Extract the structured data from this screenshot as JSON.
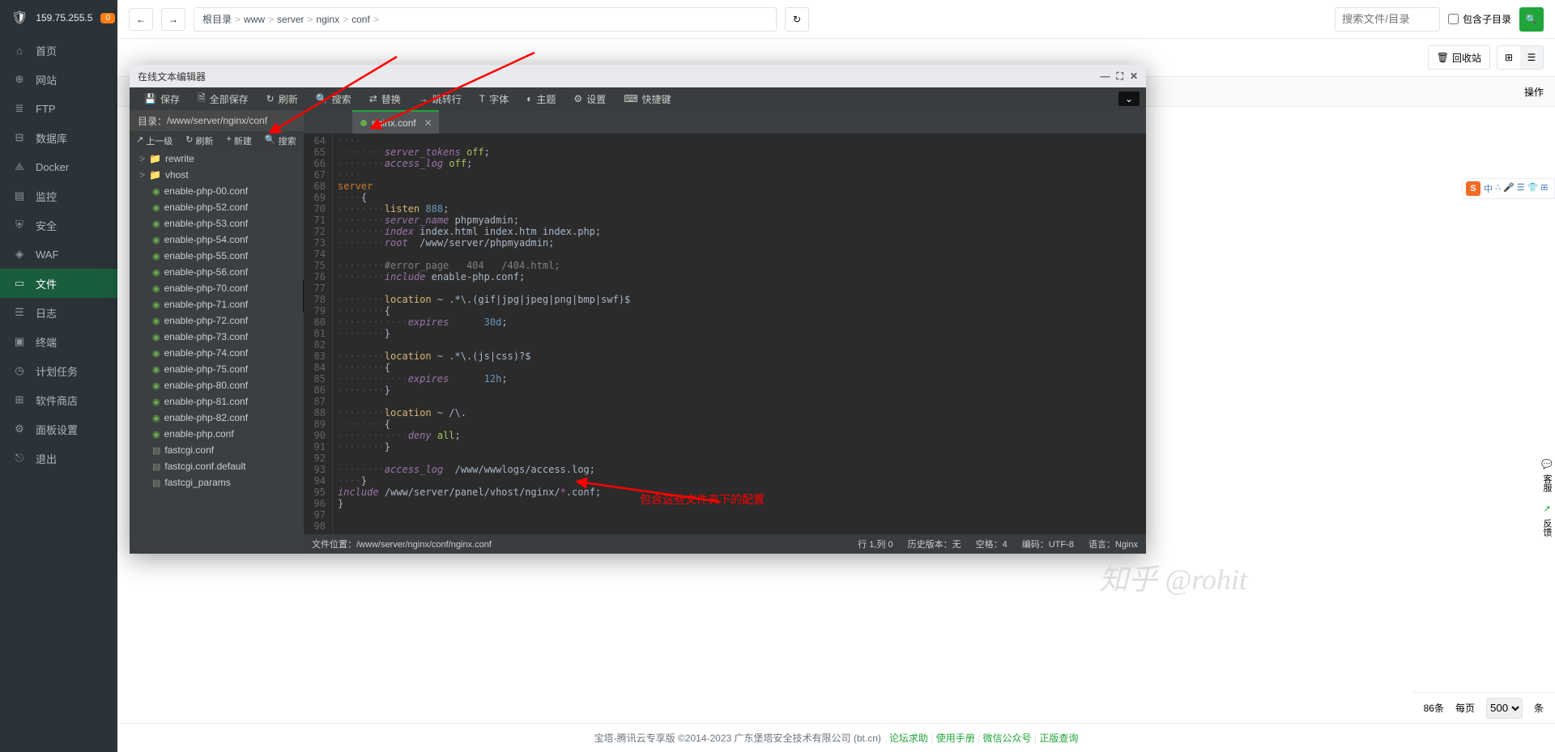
{
  "server_ip": "159.75.255.5",
  "badge": "0",
  "nav": [
    {
      "icon": "⌂",
      "label": "首页"
    },
    {
      "icon": "⊕",
      "label": "网站"
    },
    {
      "icon": "≣",
      "label": "FTP"
    },
    {
      "icon": "⊟",
      "label": "数据库"
    },
    {
      "icon": "⟁",
      "label": "Docker"
    },
    {
      "icon": "▤",
      "label": "监控"
    },
    {
      "icon": "⛨",
      "label": "安全"
    },
    {
      "icon": "◈",
      "label": "WAF"
    },
    {
      "icon": "▭",
      "label": "文件",
      "active": true
    },
    {
      "icon": "☰",
      "label": "日志"
    },
    {
      "icon": "▣",
      "label": "终端"
    },
    {
      "icon": "◷",
      "label": "计划任务"
    },
    {
      "icon": "⊞",
      "label": "软件商店"
    },
    {
      "icon": "⚙",
      "label": "面板设置"
    },
    {
      "icon": "⎋",
      "label": "退出"
    }
  ],
  "breadcrumb": [
    "根目录",
    "www",
    "server",
    "nginx",
    "conf"
  ],
  "search_placeholder": "搜索文件/目录",
  "include_subdir": "包含子目录",
  "recycle_label": "回收站",
  "table_op_header": "操作",
  "pagination": {
    "total": "86条",
    "per_page": "每页",
    "select": "500",
    "unit": "条"
  },
  "footer": {
    "copyright": "宝塔-腾讯云专享版 ©2014-2023 广东堡塔安全技术有限公司 (bt.cn)",
    "links": [
      "论坛求助",
      "使用手册",
      "微信公众号",
      "正版查询"
    ]
  },
  "modal": {
    "title": "在线文本编辑器",
    "toolbar": [
      {
        "icon": "💾",
        "label": "保存"
      },
      {
        "icon": "🗎",
        "label": "全部保存"
      },
      {
        "icon": "↻",
        "label": "刷新"
      },
      {
        "icon": "🔍",
        "label": "搜索"
      },
      {
        "icon": "⇄",
        "label": "替换"
      },
      {
        "icon": "→",
        "label": "跳转行"
      },
      {
        "icon": "T",
        "label": "字体"
      },
      {
        "icon": "◐",
        "label": "主题"
      },
      {
        "icon": "⚙",
        "label": "设置"
      },
      {
        "icon": "⌨",
        "label": "快捷键"
      }
    ],
    "path_label": "目录：",
    "path": "/www/server/nginx/conf",
    "left_toolbar": [
      {
        "icon": "↗",
        "label": "上一级"
      },
      {
        "icon": "↻",
        "label": "刷新"
      },
      {
        "icon": "+",
        "label": "新建"
      },
      {
        "icon": "🔍",
        "label": "搜索"
      }
    ],
    "tree": [
      {
        "type": "folder",
        "name": "rewrite",
        "chevron": ">"
      },
      {
        "type": "folder",
        "name": "vhost",
        "chevron": ">"
      },
      {
        "type": "conf",
        "name": "enable-php-00.conf"
      },
      {
        "type": "conf",
        "name": "enable-php-52.conf"
      },
      {
        "type": "conf",
        "name": "enable-php-53.conf"
      },
      {
        "type": "conf",
        "name": "enable-php-54.conf"
      },
      {
        "type": "conf",
        "name": "enable-php-55.conf"
      },
      {
        "type": "conf",
        "name": "enable-php-56.conf"
      },
      {
        "type": "conf",
        "name": "enable-php-70.conf"
      },
      {
        "type": "conf",
        "name": "enable-php-71.conf"
      },
      {
        "type": "conf",
        "name": "enable-php-72.conf"
      },
      {
        "type": "conf",
        "name": "enable-php-73.conf"
      },
      {
        "type": "conf",
        "name": "enable-php-74.conf"
      },
      {
        "type": "conf",
        "name": "enable-php-75.conf"
      },
      {
        "type": "conf",
        "name": "enable-php-80.conf"
      },
      {
        "type": "conf",
        "name": "enable-php-81.conf"
      },
      {
        "type": "conf",
        "name": "enable-php-82.conf"
      },
      {
        "type": "conf",
        "name": "enable-php.conf"
      },
      {
        "type": "file",
        "name": "fastcgi.conf"
      },
      {
        "type": "file",
        "name": "fastcgi.conf.default"
      },
      {
        "type": "file",
        "name": "fastcgi_params"
      }
    ],
    "tab_filename": "nginx.conf",
    "code_start_line": 64,
    "code_html": "    \n        <span class='dir'>server_tokens</span> <span class='val'>off</span><span class='pun'>;</span>\n        <span class='dir'>access_log</span> <span class='val'>off</span><span class='pun'>;</span>\n    \n<span class='kw'>server</span>\n    <span class='pun'>{</span>\n        <span class='prop'>listen</span> <span class='num'>888</span><span class='pun'>;</span>\n        <span class='dir'>server_name</span> <span class='pun'>phpmyadmin;</span>\n        <span class='dir'>index</span> <span class='pun'>index.html index.htm index.php;</span>\n        <span class='dir'>root</span>  <span class='pun'>/www/server/phpmyadmin;</span>\n\n        <span class='cmt'>#error_page   404   /404.html;</span>\n        <span class='dir'>include</span> <span class='pun'>enable-php.conf;</span>\n\n        <span class='prop'>location</span> <span class='pun'>~ .*\\.(gif|jpg|jpeg|png|bmp|swf)$</span>\n        <span class='pun'>{</span>\n            <span class='dir'>expires</span>      <span class='num'>30d</span><span class='pun'>;</span>\n        <span class='pun'>}</span>\n\n        <span class='prop'>location</span> <span class='pun'>~ .*\\.(js|css)?$</span>\n        <span class='pun'>{</span>\n            <span class='dir'>expires</span>      <span class='num'>12h</span><span class='pun'>;</span>\n        <span class='pun'>}</span>\n\n        <span class='prop'>location</span> <span class='pun'>~ /\\.</span>\n        <span class='pun'>{</span>\n            <span class='dir'>deny</span> <span class='val'>all</span><span class='pun'>;</span>\n        <span class='pun'>}</span>\n\n        <span class='dir'>access_log</span>  <span class='pun'>/www/wwwlogs/access.log;</span>\n    <span class='pun'>}</span>\n<span class='dir'>include</span> <span class='pun'>/www/server/panel/vhost/nginx/</span><span class='wild'>*</span><span class='pun'>.conf;</span>\n<span class='pun'>}</span>\n\n",
    "status": {
      "file_loc_label": "文件位置：",
      "file_loc": "/www/server/nginx/conf/nginx.conf",
      "cursor": "行 1,列 0",
      "history_label": "历史版本：",
      "history": "无",
      "indent_label": "空格：",
      "indent": "4",
      "encoding_label": "编码：",
      "encoding": "UTF-8",
      "lang_label": "语言：",
      "lang": "Nginx"
    }
  },
  "annotation": "包含这些文件夹下的配置",
  "watermark": "知乎 @rohit",
  "sogou_icons": [
    "中",
    "∴",
    "🎤",
    "☰",
    "👕",
    "⊞"
  ],
  "help_items": [
    {
      "icon": "💬",
      "label": "客服"
    },
    {
      "icon": "↗",
      "label": "反馈"
    }
  ]
}
